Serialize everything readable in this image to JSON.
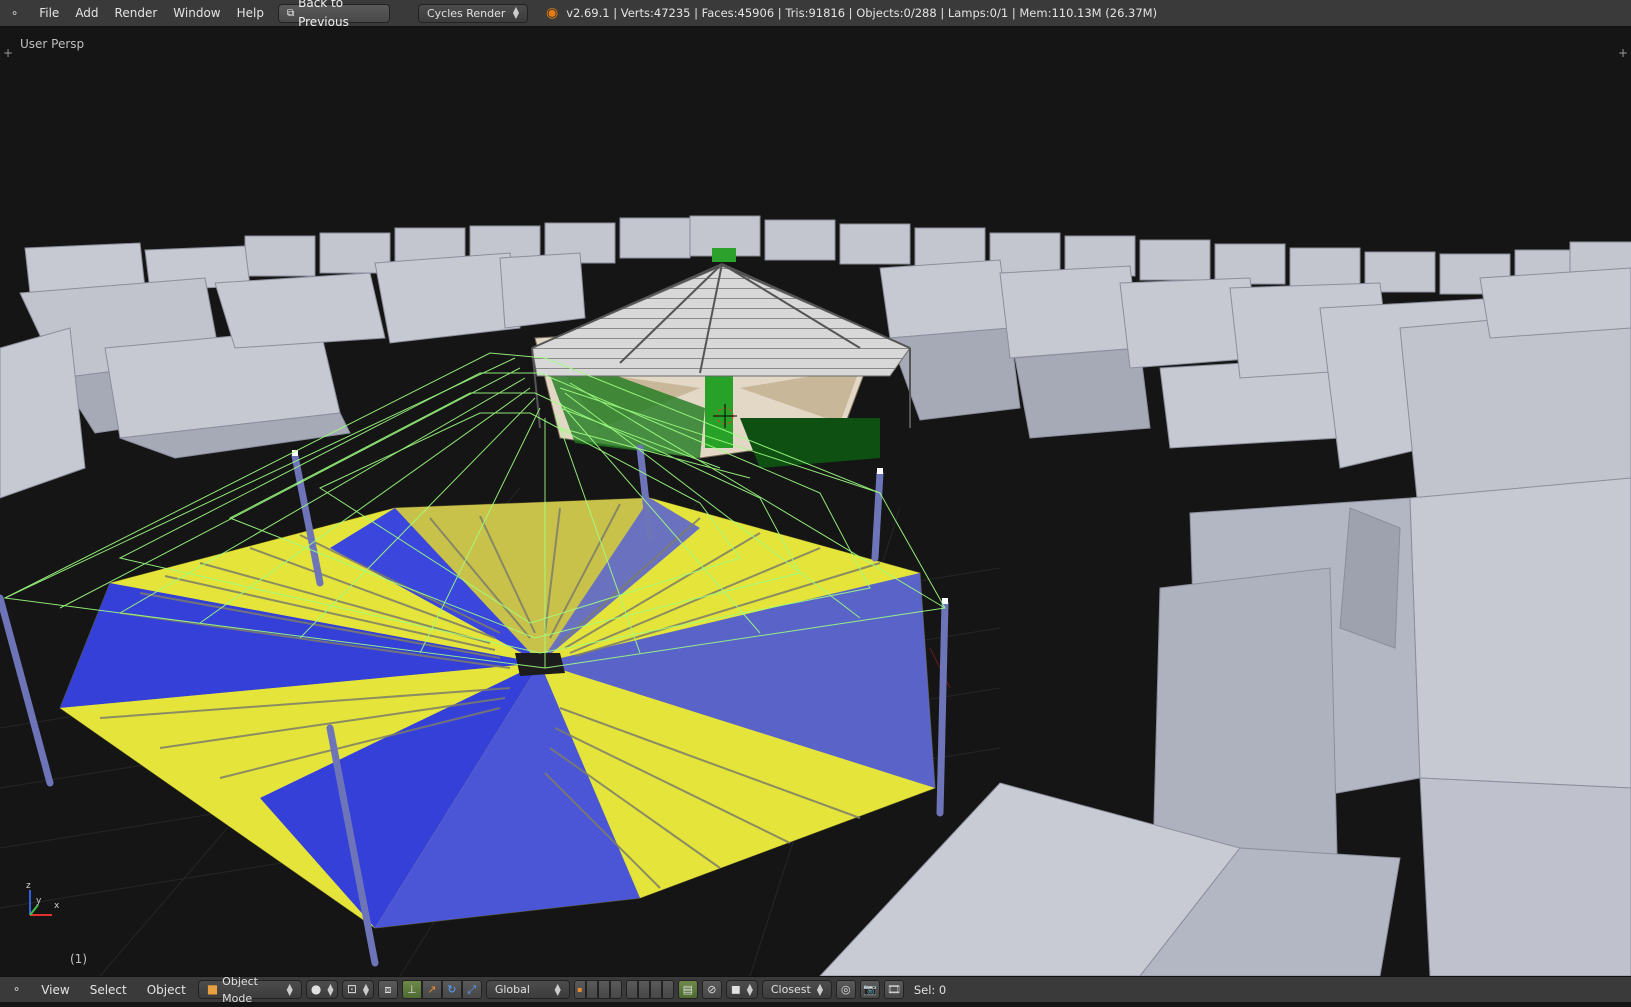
{
  "topbar": {
    "menu": [
      "File",
      "Add",
      "Render",
      "Window",
      "Help"
    ],
    "back_button": "Back to Previous",
    "render_engine": "Cycles Render",
    "stats": "v2.69.1 | Verts:47235 | Faces:45906 | Tris:91816 | Objects:0/288 | Lamps:0/1 | Mem:110.13M (26.37M)"
  },
  "viewport": {
    "view_label": "User Persp",
    "frame_label": "(1)"
  },
  "bottombar": {
    "view": "View",
    "select": "Select",
    "object": "Object",
    "mode": "Object Mode",
    "orientation": "Global",
    "snap": "Closest",
    "selection": "Sel: 0"
  },
  "colors": {
    "background": "#151515",
    "building": "#c6c8d2",
    "yellow": "#e4e43a",
    "blue": "#3440d8",
    "wire": "#9dff80",
    "green": "#1c8a1c"
  }
}
